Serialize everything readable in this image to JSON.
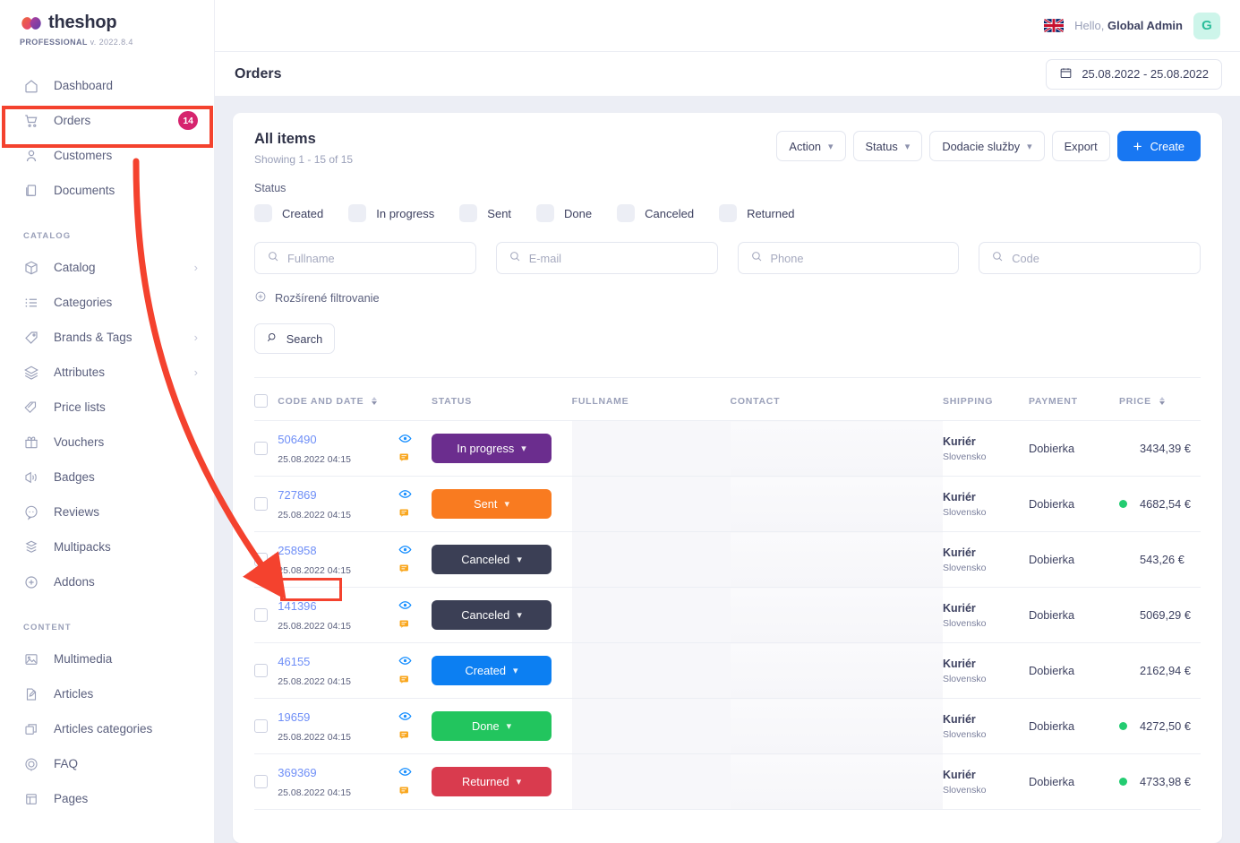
{
  "brand": {
    "name": "theshop",
    "edition": "PROFESSIONAL",
    "version": "v. 2022.8.4"
  },
  "sidebar": {
    "items": [
      {
        "label": "Dashboard",
        "icon": "home-icon",
        "badge": null,
        "chevron": false
      },
      {
        "label": "Orders",
        "icon": "cart-icon",
        "badge": "14",
        "chevron": false
      },
      {
        "label": "Customers",
        "icon": "user-icon",
        "badge": null,
        "chevron": false
      },
      {
        "label": "Documents",
        "icon": "documents-icon",
        "badge": null,
        "chevron": false
      }
    ],
    "groups": [
      {
        "title": "CATALOG",
        "items": [
          {
            "label": "Catalog",
            "icon": "box-icon",
            "chevron": true
          },
          {
            "label": "Categories",
            "icon": "list-icon",
            "chevron": false
          },
          {
            "label": "Brands & Tags",
            "icon": "tag-icon",
            "chevron": true
          },
          {
            "label": "Attributes",
            "icon": "layers-icon",
            "chevron": true
          },
          {
            "label": "Price lists",
            "icon": "pricetag-icon",
            "chevron": false
          },
          {
            "label": "Vouchers",
            "icon": "gift-icon",
            "chevron": false
          },
          {
            "label": "Badges",
            "icon": "megaphone-icon",
            "chevron": false
          },
          {
            "label": "Reviews",
            "icon": "chat-icon",
            "chevron": false
          },
          {
            "label": "Multipacks",
            "icon": "multipack-icon",
            "chevron": false
          },
          {
            "label": "Addons",
            "icon": "plus-circle-icon",
            "chevron": false
          }
        ]
      },
      {
        "title": "CONTENT",
        "items": [
          {
            "label": "Multimedia",
            "icon": "image-icon",
            "chevron": false
          },
          {
            "label": "Articles",
            "icon": "pencil-icon",
            "chevron": false
          },
          {
            "label": "Articles categories",
            "icon": "copy-icon",
            "chevron": false
          },
          {
            "label": "FAQ",
            "icon": "faq-icon",
            "chevron": false
          },
          {
            "label": "Pages",
            "icon": "page-icon",
            "chevron": false
          }
        ]
      }
    ]
  },
  "topbar": {
    "flag": "uk-flag-icon",
    "greeting_prefix": "Hello,",
    "user_name": "Global Admin",
    "avatar_initial": "G"
  },
  "pagehead": {
    "title": "Orders",
    "date_range": "25.08.2022 - 25.08.2022",
    "calendar_icon": "calendar-icon"
  },
  "card": {
    "title": "All items",
    "subtitle": "Showing 1 - 15 of 15",
    "buttons": [
      {
        "label": "Action",
        "type": "dropdown"
      },
      {
        "label": "Status",
        "type": "dropdown"
      },
      {
        "label": "Dodacie služby",
        "type": "dropdown"
      },
      {
        "label": "Export",
        "type": "plain"
      },
      {
        "label": "Create",
        "type": "primary"
      }
    ],
    "status_label": "Status",
    "status_filters": [
      "Created",
      "In progress",
      "Sent",
      "Done",
      "Canceled",
      "Returned"
    ],
    "filter_fields": [
      {
        "placeholder": "Fullname",
        "value": ""
      },
      {
        "placeholder": "E-mail",
        "value": ""
      },
      {
        "placeholder": "Phone",
        "value": ""
      },
      {
        "placeholder": "Code",
        "value": ""
      }
    ],
    "advanced_filter": "Rozšírené filtrovanie",
    "search_button": "Search"
  },
  "table": {
    "headers": {
      "code": "CODE AND DATE",
      "status": "STATUS",
      "fullname": "FULLNAME",
      "contact": "CONTACT",
      "shipping": "SHIPPING",
      "payment": "PAYMENT",
      "price": "PRICE"
    },
    "rows": [
      {
        "code": "506490",
        "date": "25.08.2022 04:15",
        "status": "In progress",
        "status_color": "#6b2d8e",
        "shipping": "Kuriér",
        "shipping_country": "Slovensko",
        "payment": "Dobierka",
        "price": "3434,39 €",
        "has_dot": false
      },
      {
        "code": "727869",
        "date": "25.08.2022 04:15",
        "status": "Sent",
        "status_color": "#f97b20",
        "shipping": "Kuriér",
        "shipping_country": "Slovensko",
        "payment": "Dobierka",
        "price": "4682,54 €",
        "has_dot": true
      },
      {
        "code": "258958",
        "date": "25.08.2022 04:15",
        "status": "Canceled",
        "status_color": "#3b3f55",
        "shipping": "Kuriér",
        "shipping_country": "Slovensko",
        "payment": "Dobierka",
        "price": "543,26 €",
        "has_dot": false
      },
      {
        "code": "141396",
        "date": "25.08.2022 04:15",
        "status": "Canceled",
        "status_color": "#3b3f55",
        "shipping": "Kuriér",
        "shipping_country": "Slovensko",
        "payment": "Dobierka",
        "price": "5069,29 €",
        "has_dot": false
      },
      {
        "code": "46155",
        "date": "25.08.2022 04:15",
        "status": "Created",
        "status_color": "#0c7ff2",
        "shipping": "Kuriér",
        "shipping_country": "Slovensko",
        "payment": "Dobierka",
        "price": "2162,94 €",
        "has_dot": false
      },
      {
        "code": "19659",
        "date": "25.08.2022 04:15",
        "status": "Done",
        "status_color": "#22c55e",
        "shipping": "Kuriér",
        "shipping_country": "Slovensko",
        "payment": "Dobierka",
        "price": "4272,50 €",
        "has_dot": true
      },
      {
        "code": "369369",
        "date": "25.08.2022 04:15",
        "status": "Returned",
        "status_color": "#d93b4e",
        "shipping": "Kuriér",
        "shipping_country": "Slovensko",
        "payment": "Dobierka",
        "price": "4733,98 €",
        "has_dot": true
      }
    ]
  },
  "annotations": {
    "highlight_color": "#f4422e",
    "boxes": [
      {
        "target": "sidebar-item-orders"
      },
      {
        "target": "order-code-258958"
      }
    ],
    "arrow": {
      "from": "sidebar-item-orders",
      "to": "order-code-258958"
    }
  },
  "colors": {
    "accent": "#1877f2",
    "badge": "#d6246e",
    "avatar_bg": "#cdf5ea",
    "link": "#6e8ef7",
    "dot_green": "#23cc71"
  }
}
